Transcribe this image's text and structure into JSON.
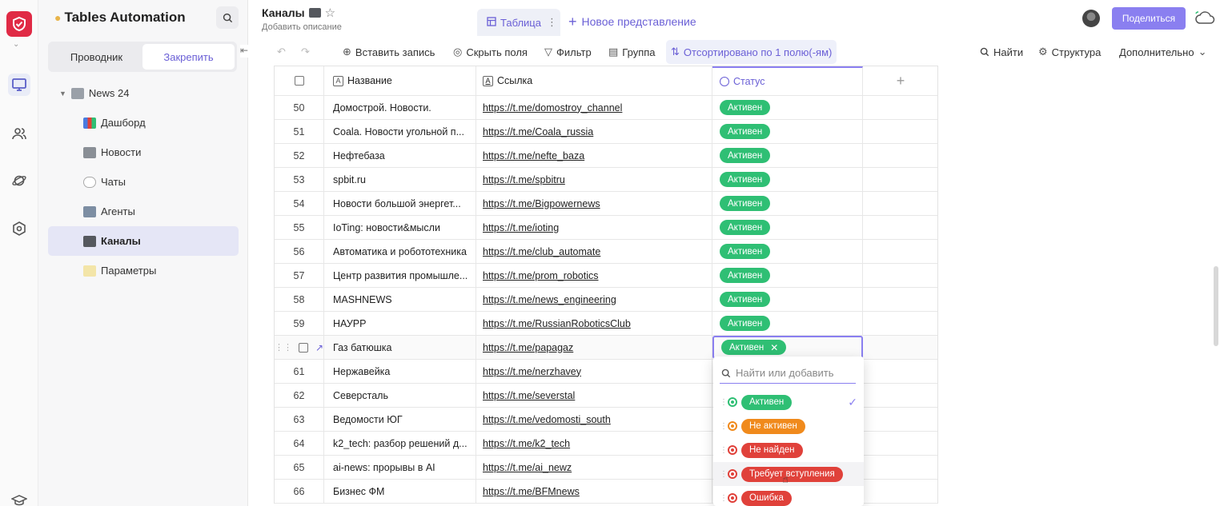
{
  "app": {
    "workspace_title": "Tables Automation",
    "page_title": "Каналы",
    "add_description": "Добавить описание"
  },
  "sidebar": {
    "segments": [
      {
        "label": "Проводник",
        "active": false
      },
      {
        "label": "Закрепить",
        "active": true
      }
    ],
    "tree": {
      "root": "News 24",
      "items": [
        {
          "label": "Дашборд",
          "icon": "chart-emoji",
          "selected": false
        },
        {
          "label": "Новости",
          "icon": "newspaper-emoji",
          "selected": false
        },
        {
          "label": "Чаты",
          "icon": "speech-bubble-emoji",
          "selected": false
        },
        {
          "label": "Агенты",
          "icon": "robot-emoji",
          "selected": false
        },
        {
          "label": "Каналы",
          "icon": "tv-emoji",
          "selected": true
        },
        {
          "label": "Параметры",
          "icon": "memo-emoji",
          "selected": false
        }
      ]
    }
  },
  "header": {
    "tab_table": "Таблица",
    "new_view": "Новое представление",
    "share": "Поделиться"
  },
  "toolbar": {
    "insert": "Вставить запись",
    "hide_fields": "Скрыть поля",
    "filter": "Фильтр",
    "group": "Группа",
    "sorted": "Отсортировано по 1 полю(-ям)",
    "find": "Найти",
    "structure": "Структура",
    "more": "Дополнительно"
  },
  "table": {
    "columns": {
      "name": "Название",
      "link": "Ссылка",
      "status": "Статус"
    },
    "rows": [
      {
        "num": "50",
        "name": "Домострой. Новости.",
        "link": "https://t.me/domostroy_channel",
        "status": "Активен"
      },
      {
        "num": "51",
        "name": "Coala. Новости угольной п...",
        "link": "https://t.me/Coala_russia",
        "status": "Активен"
      },
      {
        "num": "52",
        "name": "Нефтебаза",
        "link": "https://t.me/nefte_baza",
        "status": "Активен"
      },
      {
        "num": "53",
        "name": "spbit.ru",
        "link": "https://t.me/spbitru",
        "status": "Активен"
      },
      {
        "num": "54",
        "name": "Новости большой энергет...",
        "link": "https://t.me/Bigpowernews",
        "status": "Активен"
      },
      {
        "num": "55",
        "name": "IoTing: новости&мысли",
        "link": "https://t.me/ioting",
        "status": "Активен"
      },
      {
        "num": "56",
        "name": "Автоматика и робототехника",
        "link": "https://t.me/club_automate",
        "status": "Активен"
      },
      {
        "num": "57",
        "name": "Центр развития промышле...",
        "link": "https://t.me/prom_robotics",
        "status": "Активен"
      },
      {
        "num": "58",
        "name": "MASHNEWS",
        "link": "https://t.me/news_engineering",
        "status": "Активен"
      },
      {
        "num": "59",
        "name": "НАУРР",
        "link": "https://t.me/RussianRoboticsClub",
        "status": "Активен"
      },
      {
        "num": "",
        "name": "Газ батюшка",
        "link": "https://t.me/papagaz",
        "status": "Активен",
        "editing": true
      },
      {
        "num": "61",
        "name": "Нержавейка",
        "link": "https://t.me/nerzhavey",
        "status": ""
      },
      {
        "num": "62",
        "name": "Северсталь",
        "link": "https://t.me/severstal",
        "status": ""
      },
      {
        "num": "63",
        "name": "Ведомости ЮГ",
        "link": "https://t.me/vedomosti_south",
        "status": ""
      },
      {
        "num": "64",
        "name": "k2_tech: разбор решений д...",
        "link": "https://t.me/k2_tech",
        "status": ""
      },
      {
        "num": "65",
        "name": "ai-news: прорывы в AI",
        "link": "https://t.me/ai_newz",
        "status": ""
      },
      {
        "num": "66",
        "name": "Бизнес ФМ",
        "link": "https://t.me/BFMnews",
        "status": ""
      }
    ]
  },
  "dropdown": {
    "search_placeholder": "Найти или добавить",
    "options": [
      {
        "label": "Активен",
        "color": "#2fbf74",
        "checked": true,
        "hover": false
      },
      {
        "label": "Не активен",
        "color": "#f08a1c",
        "checked": false,
        "hover": false
      },
      {
        "label": "Не найден",
        "color": "#e0413a",
        "checked": false,
        "hover": false
      },
      {
        "label": "Требует вступления",
        "color": "#e0413a",
        "checked": false,
        "hover": true
      },
      {
        "label": "Ошибка",
        "color": "#e0413a",
        "checked": false,
        "hover": false
      }
    ]
  },
  "colors": {
    "accent": "#8a7ff0",
    "active_status": "#2fbf74",
    "brand_red": "#e02a45"
  }
}
